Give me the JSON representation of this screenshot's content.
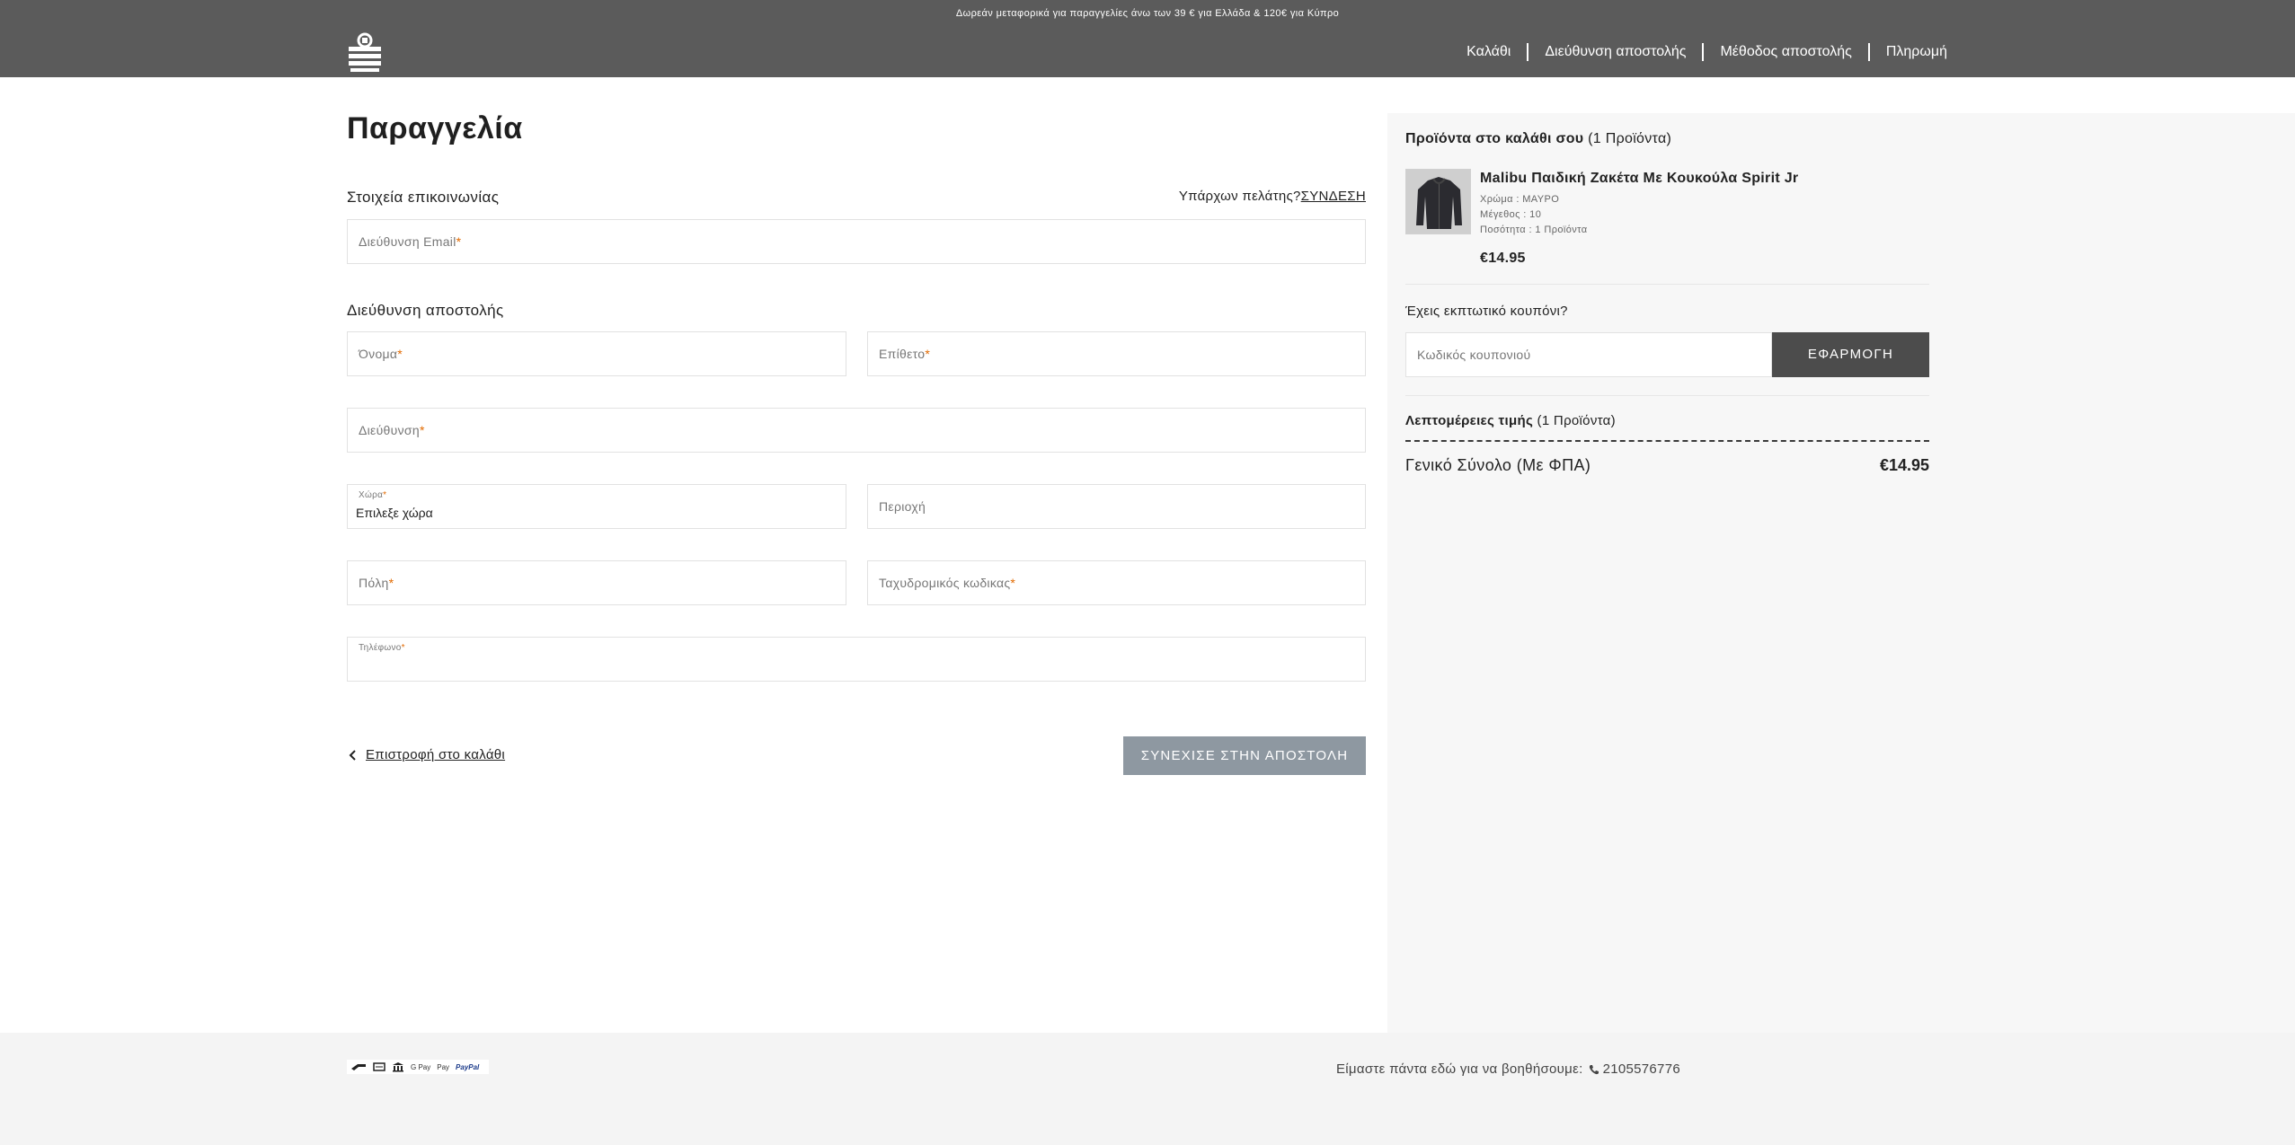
{
  "header": {
    "promo": "Δωρεάν μεταφορικά για παραγγελίες άνω των 39 € για Ελλάδα & 120€ για Κύπρο",
    "steps": [
      "Καλάθι",
      "Διεύθυνση αποστολής",
      "Μέθοδος αποστολής",
      "Πληρωμή"
    ]
  },
  "main": {
    "title": "Παραγγελία",
    "contact": {
      "label": "Στοιχεία επικοινωνίας",
      "existing_customer": "Υπάρχων πελάτης?",
      "login": "ΣΥΝΔΕΣΗ",
      "email_placeholder": "Διεύθυνση Email"
    },
    "shipping": {
      "label": "Διεύθυνση αποστολής",
      "first_name": "Όνομα",
      "last_name": "Επίθετο",
      "address": "Διεύθυνση",
      "country_label": "Χώρα",
      "country_value": "Επιλεξε χώρα",
      "region": "Περιοχή",
      "city": "Πόλη",
      "postal_code": "Ταχυδρομικός κωδικας",
      "phone": "Τηλέφωνο"
    },
    "required_mark": "*",
    "back_label": "Επιστροφή στο καλάθι",
    "continue_label": "ΣΥΝΕΧΙΣΕ ΣΤΗΝ ΑΠΟΣΤΟΛΗ"
  },
  "summary": {
    "cart_title": "Προϊόντα στο καλάθι σου",
    "cart_count": "(1 Προϊόντα)",
    "product": {
      "name": "Malibu Παιδική Ζακέτα Με Κουκούλα Spirit Jr",
      "color": "Χρώμα : ΜΑΥΡΟ",
      "size": "Μέγεθος : 10",
      "quantity": "Ποσότητα : 1 Προϊόντα",
      "price": "€14.95"
    },
    "coupon_question": "Έχεις εκπτωτικό κουπόνι?",
    "coupon_placeholder": "Κωδικός κουπονιού",
    "apply_label": "ΕΦΑΡΜΟΓΗ",
    "price_details": "Λεπτομέρειες τιμής",
    "price_count": "(1 Προϊόντα)",
    "total_label": "Γενικό Σύνολο (Με ΦΠΑ)",
    "total_value": "€14.95"
  },
  "footer": {
    "payment_icons": [
      "G Pay",
      "Pay",
      "PayPal"
    ],
    "help_text": "Είμαστε πάντα εδώ για να βοηθήσουμε:",
    "phone": "2105576776"
  },
  "colors": {
    "header_bg": "#5b5b5b",
    "continue_bg": "#8e98a1",
    "apply_bg": "#4c4c4c",
    "required": "#e26a00"
  }
}
